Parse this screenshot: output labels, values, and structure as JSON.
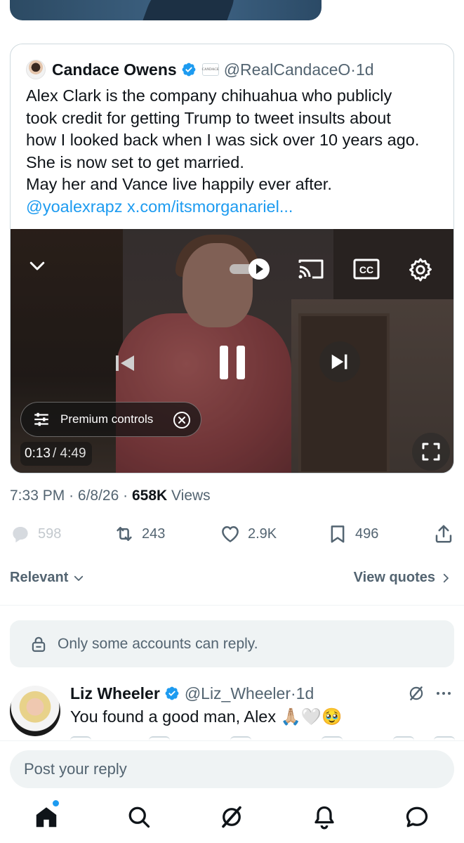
{
  "quoted_tweet": {
    "author_name": "Candace Owens",
    "affiliate_badge_text": "CANDACE",
    "handle": "@RealCandaceO",
    "separator": "·",
    "age": "1d",
    "text_lines": [
      "Alex Clark is the company chihuahua who publicly",
      "took credit for getting Trump to tweet insults about",
      "how I looked back when I was sick over 10 years ago.",
      "She is now set to get married.",
      "May her and Vance live happily ever after."
    ],
    "mention_link": "@yoalexrapz",
    "url_link": "x.com/itsmorganariel..."
  },
  "video": {
    "premium_controls_label": "Premium controls",
    "current_time": "0:13",
    "duration": "/ 4:49",
    "icons": [
      "chevron-down-icon",
      "autoplay-toggle-icon",
      "cast-icon",
      "closed-captions-icon",
      "settings-icon",
      "skip-previous-icon",
      "pause-icon",
      "skip-next-icon",
      "fullscreen-icon",
      "close-icon"
    ]
  },
  "meta": {
    "time": "7:33 PM",
    "date": "6/8/26",
    "views_count": "658K",
    "views_label": "Views",
    "dot": "·"
  },
  "actions": {
    "replies": "598",
    "reposts": "243",
    "likes": "2.9K",
    "bookmarks": "496"
  },
  "sort": {
    "relevant_label": "Relevant",
    "view_quotes_label": "View quotes"
  },
  "reply_notice": "Only some accounts can reply.",
  "reply": {
    "author_name": "Liz Wheeler",
    "handle": "@Liz_Wheeler",
    "separator": "·",
    "age": "1d",
    "text": "You found a good man, Alex 🙏🏼🤍🥹"
  },
  "composer": {
    "placeholder": "Post your reply"
  },
  "tabbar": {
    "items": [
      "home-icon",
      "search-icon",
      "grok-icon",
      "notifications-icon",
      "messages-icon"
    ]
  },
  "colors": {
    "accent": "#1d9bf0",
    "text_primary": "#0f1419",
    "text_secondary": "#536471",
    "border": "#cfd9de"
  }
}
